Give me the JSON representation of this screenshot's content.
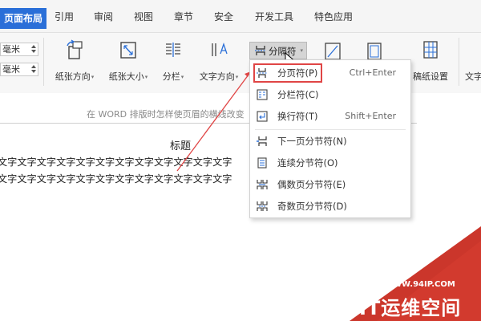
{
  "tabs": [
    {
      "label": "页面布局",
      "active": true
    },
    {
      "label": "引用",
      "active": false
    },
    {
      "label": "审阅",
      "active": false
    },
    {
      "label": "视图",
      "active": false
    },
    {
      "label": "章节",
      "active": false
    },
    {
      "label": "安全",
      "active": false
    },
    {
      "label": "开发工具",
      "active": false
    },
    {
      "label": "特色应用",
      "active": false
    }
  ],
  "ribbon": {
    "margin_unit_1": "毫米",
    "margin_unit_2": "毫米",
    "orientation_label": "纸张方向",
    "size_label": "纸张大小",
    "columns_label": "分栏",
    "text_direction_label": "文字方向",
    "breaks_label": "分隔符",
    "manuscript_label": "稿纸设置",
    "text_label": "文字"
  },
  "document": {
    "header_hint": "在 WORD 排版时怎样使页眉的横线改变",
    "title": "标题",
    "line1": "文字文字文字文字文字文字文字文字文字文字文字文字",
    "line2": "文字文字文字文字文字文字文字文字文字文字文字文字"
  },
  "menu": {
    "items": [
      {
        "label": "分页符(P)",
        "shortcut": "Ctrl+Enter",
        "icon": "page-break-icon"
      },
      {
        "label": "分栏符(C)",
        "shortcut": "",
        "icon": "column-break-icon"
      },
      {
        "label": "换行符(T)",
        "shortcut": "Shift+Enter",
        "icon": "line-break-icon"
      },
      {
        "label": "下一页分节符(N)",
        "shortcut": "",
        "icon": "next-page-section-icon"
      },
      {
        "label": "连续分节符(O)",
        "shortcut": "",
        "icon": "continuous-section-icon"
      },
      {
        "label": "偶数页分节符(E)",
        "shortcut": "",
        "icon": "even-page-section-icon"
      },
      {
        "label": "奇数页分节符(D)",
        "shortcut": "",
        "icon": "odd-page-section-icon"
      }
    ]
  },
  "watermark": {
    "url": "WWW.94IP.COM",
    "title": "IT运维空间"
  },
  "colors": {
    "active_tab": "#2a6fd8",
    "highlight_box": "#e04545",
    "arrow": "#e04545",
    "watermark_bg": "#d23a2e"
  }
}
